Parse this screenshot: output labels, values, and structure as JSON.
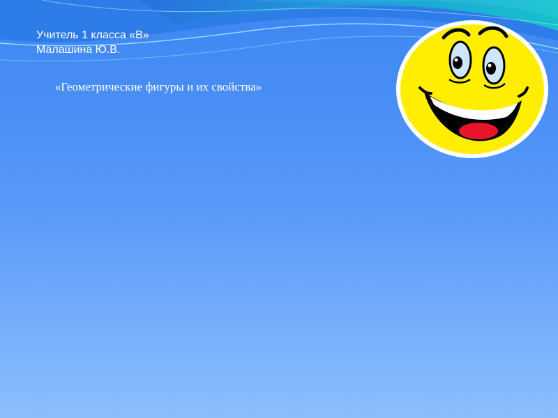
{
  "slide": {
    "teacher_line": "Учитель 1 класса «В»",
    "name_line": "Малашина Ю.В.",
    "title": "«Геометрические фигуры и их свойства»"
  },
  "decorations": {
    "top_wave": "wave-decoration",
    "smiley": "smiley-face-icon"
  },
  "colors": {
    "background_top": "#3d86f2",
    "background_bottom": "#8cbefb",
    "text": "#ffffff",
    "smiley_yellow": "#ffee00",
    "wave_teal": "#19b6c8"
  }
}
